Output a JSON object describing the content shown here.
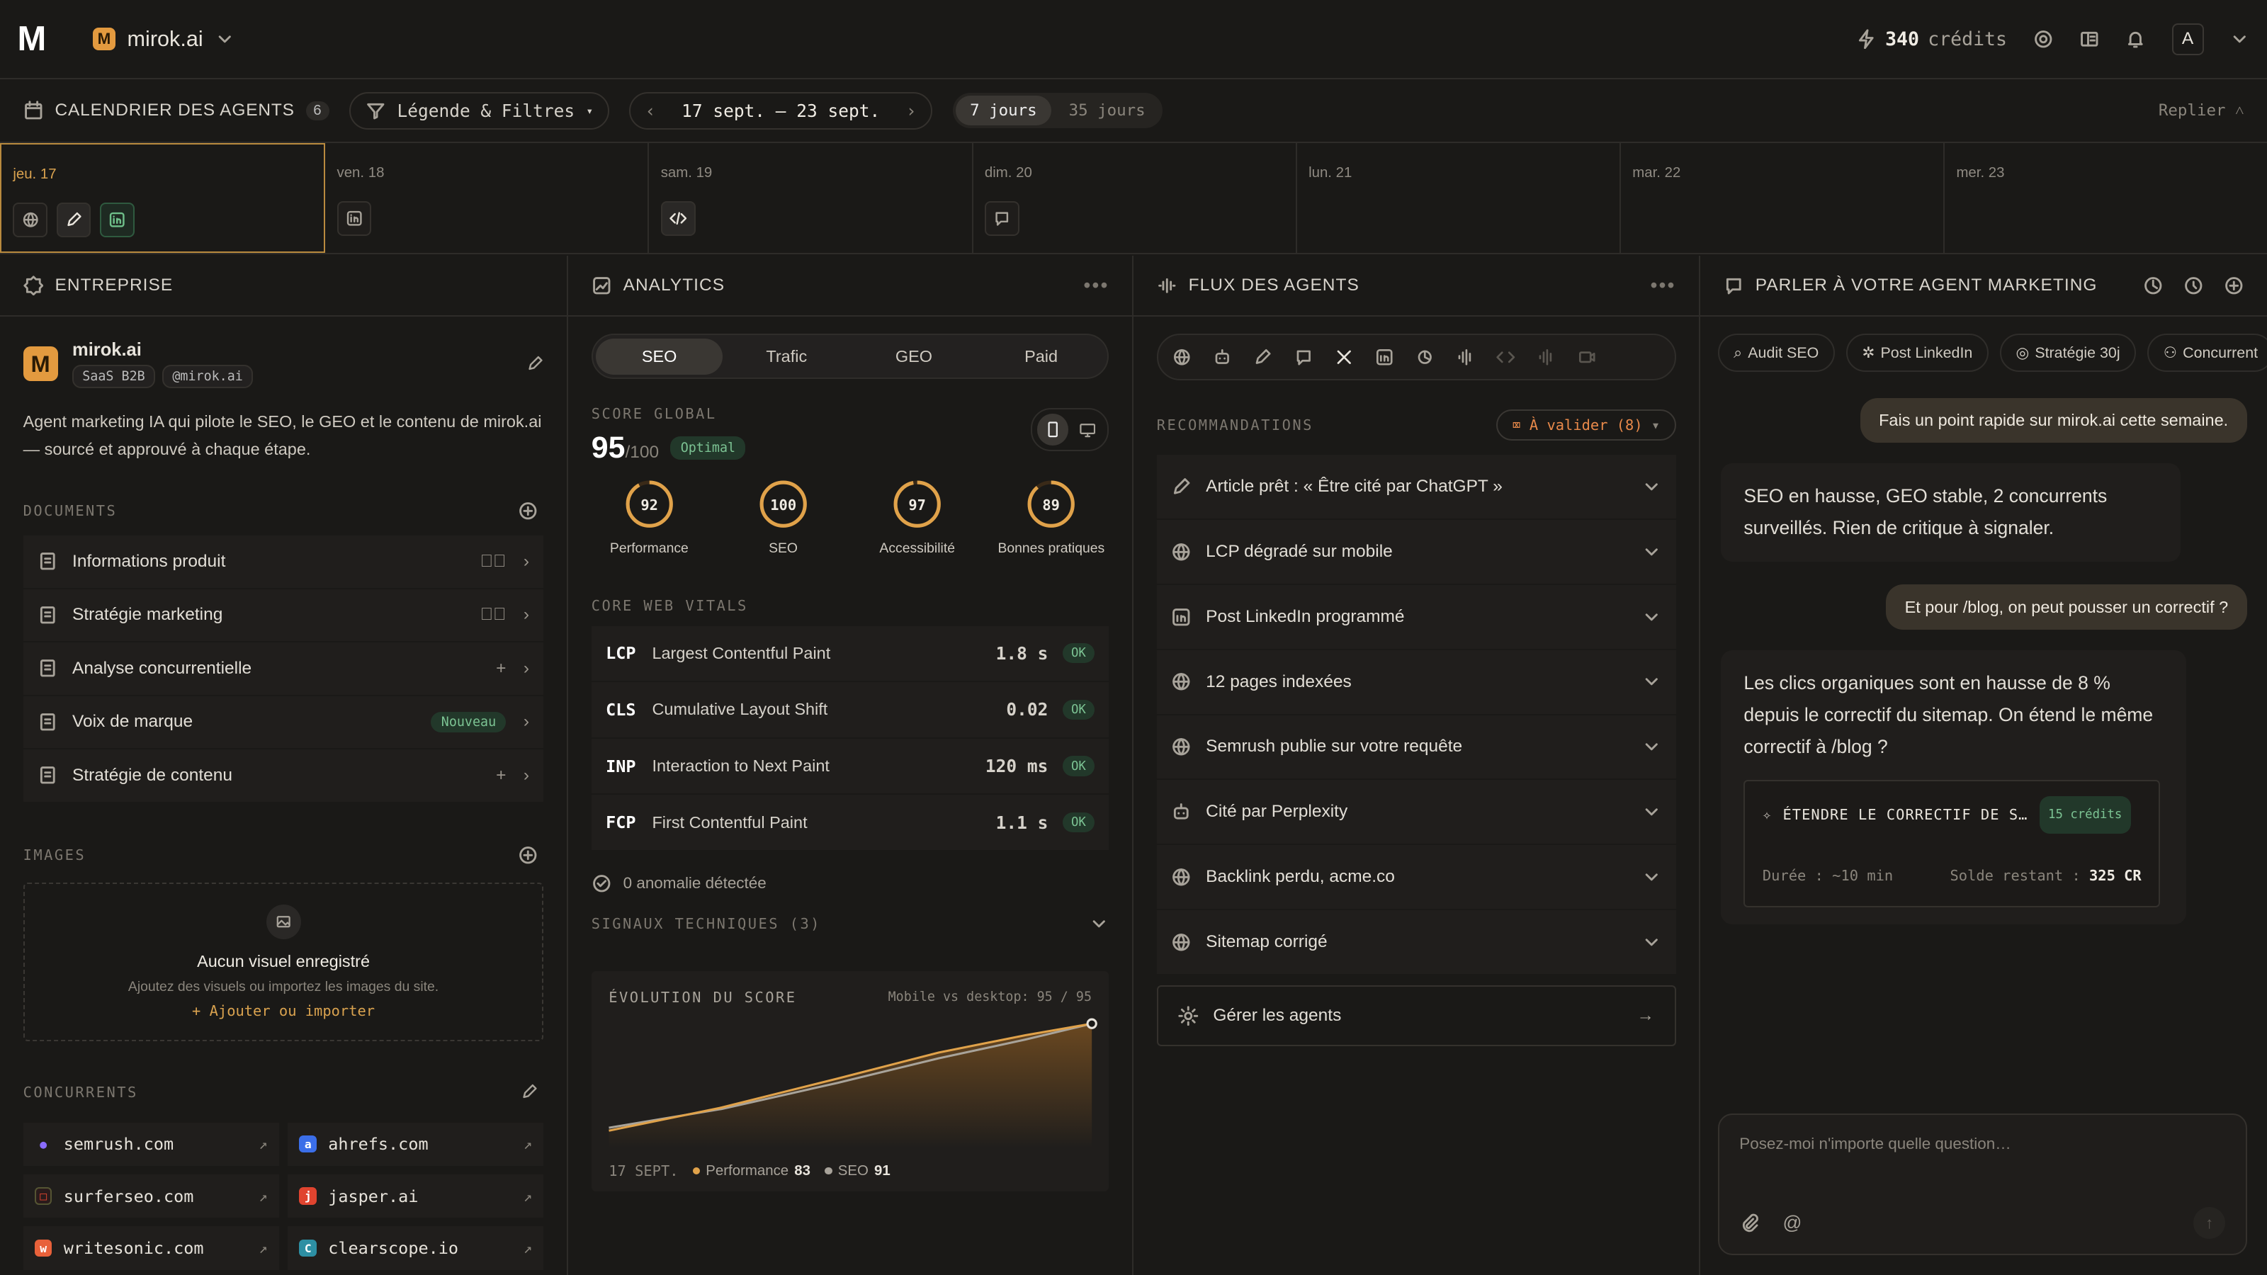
{
  "topbar": {
    "logo": "M",
    "workspace_initial": "M",
    "workspace": "mirok.ai",
    "credits_value": "340",
    "credits_label": "crédits",
    "avatar": "A"
  },
  "calendar": {
    "title": "CALENDRIER DES AGENTS",
    "count": "6",
    "filters": "Légende & Filtres",
    "range": "17 sept. – 23 sept.",
    "view_7": "7 jours",
    "view_35": "35 jours",
    "collapse": "Replier",
    "days": [
      "jeu. 17",
      "ven. 18",
      "sam. 19",
      "dim. 20",
      "lun. 21",
      "mar. 22",
      "mer. 23"
    ]
  },
  "entreprise": {
    "header": "ENTREPRISE",
    "name": "mirok.ai",
    "tag1": "SaaS B2B",
    "tag2": "@mirok.ai",
    "description": "Agent marketing IA qui pilote le SEO, le GEO et le contenu de mirok.ai — sourcé et approuvé à chaque étape.",
    "documents_title": "DOCUMENTS",
    "documents": [
      {
        "label": "Informations produit"
      },
      {
        "label": "Stratégie marketing"
      },
      {
        "label": "Analyse concurrentielle"
      },
      {
        "label": "Voix de marque",
        "badge": "Nouveau"
      },
      {
        "label": "Stratégie de contenu"
      }
    ],
    "images_title": "IMAGES",
    "images_empty_title": "Aucun visuel enregistré",
    "images_empty_sub": "Ajoutez des visuels ou importez les images du site.",
    "images_add": "+ Ajouter ou importer",
    "competitors_title": "CONCURRENTS",
    "competitors": [
      {
        "name": "semrush.com",
        "color": "#6a4cff",
        "letter": "●"
      },
      {
        "name": "ahrefs.com",
        "color": "#3b6ee8",
        "letter": "a"
      },
      {
        "name": "surferseo.com",
        "color": "#2a1b1b",
        "letter": "□"
      },
      {
        "name": "jasper.ai",
        "color": "#e0442f",
        "letter": "j"
      },
      {
        "name": "writesonic.com",
        "color": "#e8613a",
        "letter": "w"
      },
      {
        "name": "clearscope.io",
        "color": "#2d8fa3",
        "letter": "C"
      }
    ]
  },
  "analytics": {
    "header": "ANALYTICS",
    "tabs": [
      "SEO",
      "Trafic",
      "GEO",
      "Paid"
    ],
    "score_title": "SCORE GLOBAL",
    "score": "95",
    "score_max": "/100",
    "score_badge": "Optimal",
    "rings": [
      {
        "value": "92",
        "label": "Performance",
        "pct": 0.92
      },
      {
        "value": "100",
        "label": "SEO",
        "pct": 1.0
      },
      {
        "value": "97",
        "label": "Accessibilité",
        "pct": 0.97
      },
      {
        "value": "89",
        "label": "Bonnes pratiques",
        "pct": 0.89
      }
    ],
    "cwv_title": "CORE WEB VITALS",
    "cwv": [
      {
        "code": "LCP",
        "name": "Largest Contentful Paint",
        "value": "1.8 s",
        "status": "OK"
      },
      {
        "code": "CLS",
        "name": "Cumulative Layout Shift",
        "value": "0.02",
        "status": "OK"
      },
      {
        "code": "INP",
        "name": "Interaction to Next Paint",
        "value": "120 ms",
        "status": "OK"
      },
      {
        "code": "FCP",
        "name": "First Contentful Paint",
        "value": "1.1 s",
        "status": "OK"
      }
    ],
    "anomaly": "0 anomalie détectée",
    "signals": "SIGNAUX TECHNIQUES (3)",
    "chart_data": {
      "type": "area",
      "title": "ÉVOLUTION DU SCORE",
      "subtitle": "Mobile vs desktop: 95 / 95",
      "x_start_label": "17 SEPT.",
      "series": [
        {
          "name": "Performance",
          "color": "#e0a24a",
          "end_value": "83"
        },
        {
          "name": "SEO",
          "color": "#a8a39a",
          "end_value": "91"
        }
      ]
    }
  },
  "flux": {
    "header": "FLUX DES AGENTS",
    "recs_title": "RECOMMANDATIONS",
    "to_validate": "À valider (8)",
    "recs": [
      {
        "icon": "pencil",
        "label": "Article prêt : « Être cité par ChatGPT »"
      },
      {
        "icon": "globe",
        "label": "LCP dégradé sur mobile"
      },
      {
        "icon": "linkedin",
        "label": "Post LinkedIn programmé"
      },
      {
        "icon": "globe",
        "label": "12 pages indexées"
      },
      {
        "icon": "globe",
        "label": "Semrush publie sur votre requête"
      },
      {
        "icon": "robot",
        "label": "Cité par Perplexity"
      },
      {
        "icon": "globe",
        "label": "Backlink perdu, acme.co"
      },
      {
        "icon": "globe",
        "label": "Sitemap corrigé"
      }
    ],
    "manage": "Gérer les agents"
  },
  "chat": {
    "header": "PARLER À VOTRE AGENT MARKETING",
    "chips": [
      "Audit SEO",
      "Post LinkedIn",
      "Stratégie 30j",
      "Concurrent"
    ],
    "msg1": "Fais un point rapide sur mirok.ai cette semaine.",
    "reply1": "SEO en hausse, GEO stable, 2 concurrents surveillés. Rien de critique à signaler.",
    "msg2": "Et pour /blog, on peut pousser un correctif ?",
    "reply2": "Les clics organiques sont en hausse de 8 % depuis le correctif du sitemap. On étend le même correctif à /blog ?",
    "action_title": "ÉTENDRE LE CORRECTIF DE S…",
    "action_cost": "15 crédits",
    "action_duration": "Durée : ~10 min",
    "action_balance_label": "Solde restant :",
    "action_balance": "325 CR",
    "placeholder": "Posez-moi n'importe quelle question…"
  }
}
